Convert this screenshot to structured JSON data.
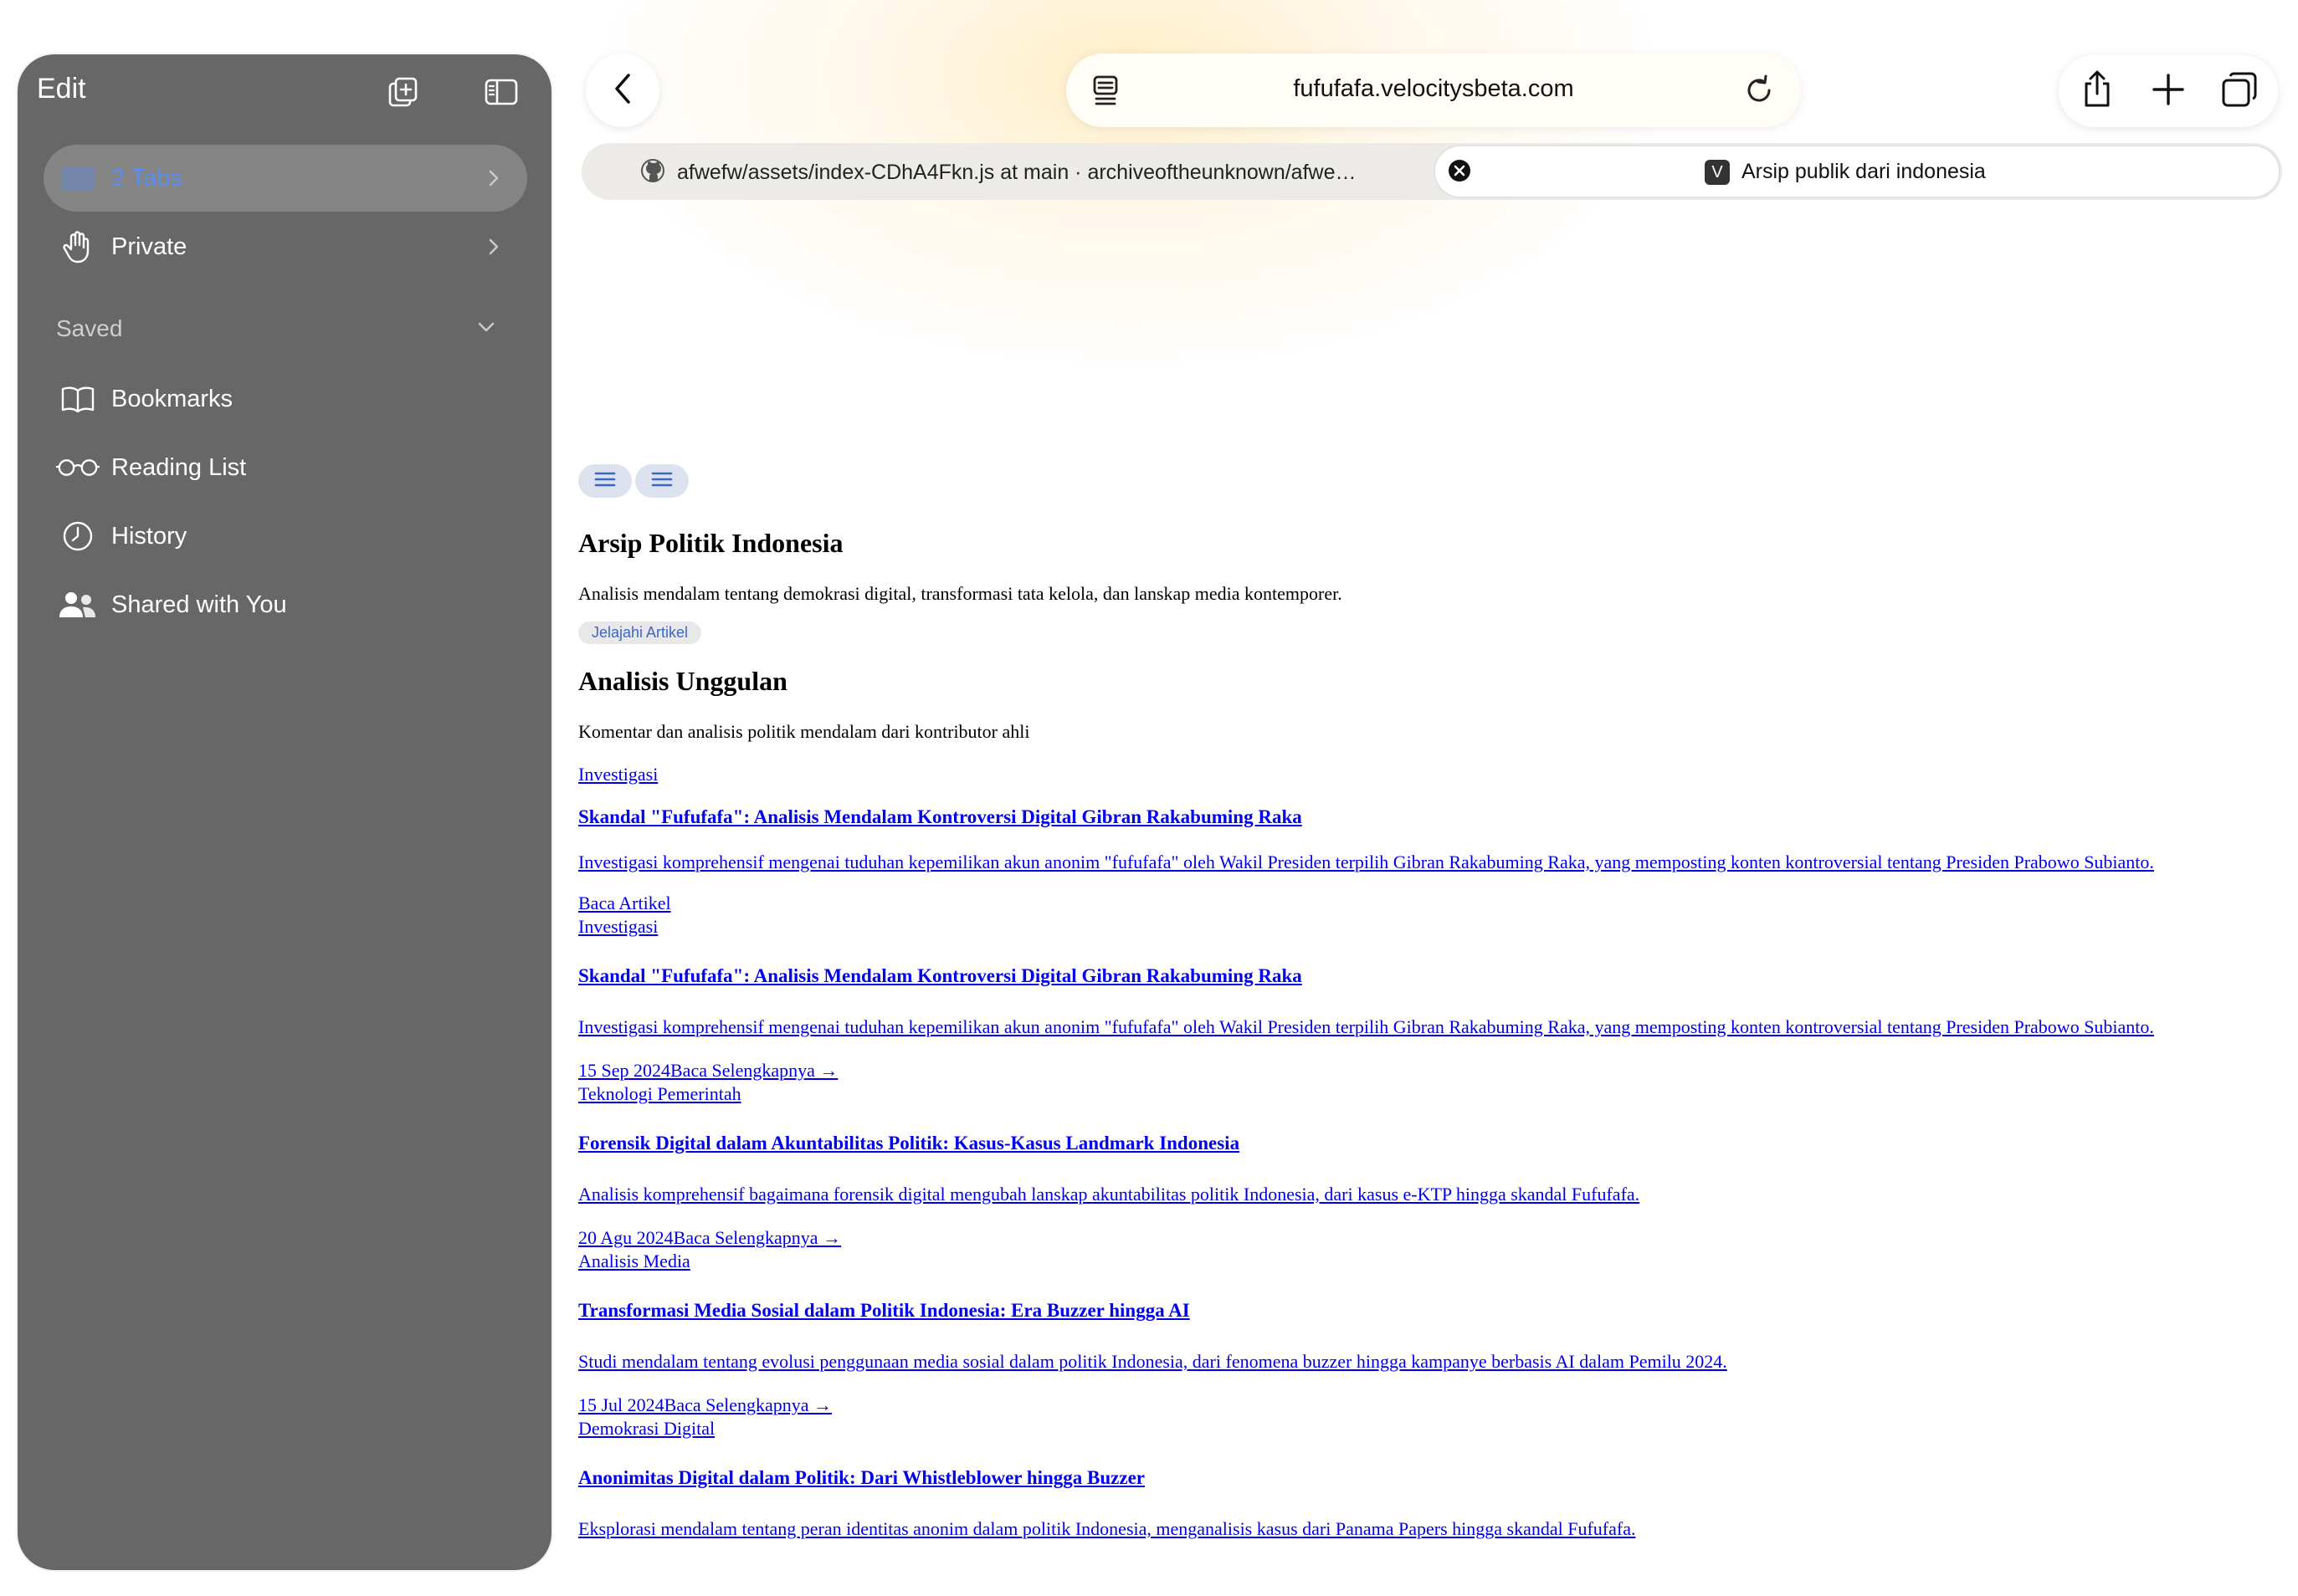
{
  "sidebar": {
    "edit_label": "Edit",
    "items": [
      {
        "label": "2 Tabs",
        "icon": "tabs-icon",
        "active": true
      },
      {
        "label": "Private",
        "icon": "hand-icon",
        "active": false
      }
    ],
    "saved_label": "Saved",
    "saved_items": [
      {
        "label": "Bookmarks",
        "icon": "book-icon"
      },
      {
        "label": "Reading List",
        "icon": "glasses-icon"
      },
      {
        "label": "History",
        "icon": "clock-icon"
      },
      {
        "label": "Shared with You",
        "icon": "people-icon"
      }
    ]
  },
  "toolbar": {
    "url": "fufufafa.velocitysbeta.com"
  },
  "tabs": [
    {
      "label": "afwefw/assets/index-CDhA4Fkn.js at main · archiveoftheunknown/afwe…",
      "favicon": "github-icon"
    },
    {
      "label": "Arsip publik dari indonesia",
      "favicon_letter": "V",
      "active": true
    }
  ],
  "page": {
    "title": "Arsip Politik Indonesia",
    "description": "Analisis mendalam tentang demokrasi digital, transformasi tata kelola, dan lanskap media kontemporer.",
    "explore_button": "Jelajahi Artikel",
    "featured_title": "Analisis Unggulan",
    "featured_subtitle": "Komentar dan analisis politik mendalam dari kontributor ahli",
    "cards": [
      {
        "category": "Investigasi",
        "title": "Skandal \"Fufufafa\": Analisis Mendalam Kontroversi Digital Gibran Rakabuming Raka",
        "excerpt": "Investigasi komprehensif mengenai tuduhan kepemilikan akun anonim \"fufufafa\" oleh Wakil Presiden terpilih Gibran Rakabuming Raka, yang memposting konten kontroversial tentang Presiden Prabowo Subianto.",
        "footer": "Baca Artikel"
      },
      {
        "category": "Investigasi",
        "title": "Skandal \"Fufufafa\": Analisis Mendalam Kontroversi Digital Gibran Rakabuming Raka",
        "excerpt": "Investigasi komprehensif mengenai tuduhan kepemilikan akun anonim \"fufufafa\" oleh Wakil Presiden terpilih Gibran Rakabuming Raka, yang memposting konten kontroversial tentang Presiden Prabowo Subianto.",
        "footer": "15 Sep 2024Baca Selengkapnya →"
      },
      {
        "category": "Teknologi Pemerintah",
        "title": "Forensik Digital dalam Akuntabilitas Politik: Kasus-Kasus Landmark Indonesia",
        "excerpt": "Analisis komprehensif bagaimana forensik digital mengubah lanskap akuntabilitas politik Indonesia, dari kasus e-KTP hingga skandal Fufufafa.",
        "footer": "20 Agu 2024Baca Selengkapnya →"
      },
      {
        "category": "Analisis Media",
        "title": "Transformasi Media Sosial dalam Politik Indonesia: Era Buzzer hingga AI",
        "excerpt": "Studi mendalam tentang evolusi penggunaan media sosial dalam politik Indonesia, dari fenomena buzzer hingga kampanye berbasis AI dalam Pemilu 2024.",
        "footer": "15 Jul 2024Baca Selengkapnya →"
      },
      {
        "category": "Demokrasi Digital",
        "title": "Anonimitas Digital dalam Politik: Dari Whistleblower hingga Buzzer",
        "excerpt": "Eksplorasi mendalam tentang peran identitas anonim dalam politik Indonesia, menganalisis kasus dari Panama Papers hingga skandal Fufufafa."
      }
    ]
  }
}
